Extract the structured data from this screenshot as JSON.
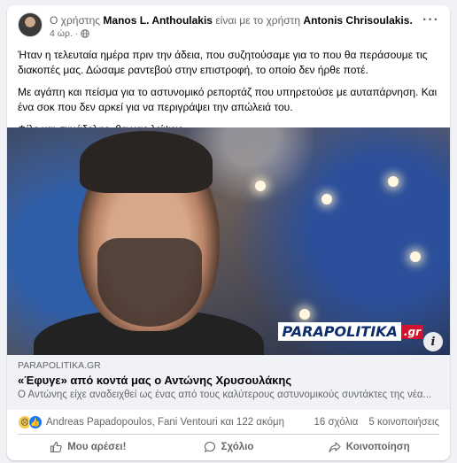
{
  "post": {
    "headline_prefix": "Ο χρήστης",
    "author": "Manos L. Anthoulakis",
    "headline_middle": "είναι με το χρήστη",
    "tagged": "Antonis Chrisoulakis.",
    "time": "4 ώρ.",
    "visibility_icon": "globe-icon",
    "more_icon": "more-dots-icon",
    "paragraphs": [
      "Ήταν η τελευταία ημέρα πριν την άδεια, που συζητούσαμε για το που θα περάσουμε τις διακοπές μας. Δώσαμε ραντεβού στην επιστροφή, το οποίο δεν ήρθε ποτέ.",
      "Με αγάπη και πείσμα για το αστυνομικό ρεπορτάζ που υπηρετούσε με αυταπάρνηση. Και ένα σοκ που δεν αρκεί για να περιγράψει την απώλειά του.",
      "Φίλε και συνάδελφε, θα μας λείψεις."
    ]
  },
  "image": {
    "logo_main": "PARAPOLITIKA",
    "logo_suffix": ".gr",
    "info_label": "i"
  },
  "link": {
    "domain": "PARAPOLITIKA.GR",
    "title": "«Έφυγε» από κοντά μας ο Αντώνης Χρυσουλάκης",
    "description": "Ο Αντώνης είχε αναδειχθεί ως ένας από τους καλύτερους αστυνομικούς συντάκτες της νέα..."
  },
  "reactions": {
    "summary": "Andreas Papadopoulos, Fani Ventouri και 122 ακόμη",
    "comments": "16 σχόλια",
    "shares": "5 κοινοποιήσεις",
    "icons": [
      "sad-reaction-icon",
      "like-reaction-icon"
    ]
  },
  "actions": {
    "like": "Μου αρέσει!",
    "comment": "Σχόλιο",
    "share": "Κοινοποίηση"
  },
  "colors": {
    "brand_blue": "#1877f2",
    "text_secondary": "#65676b",
    "logo_red": "#d0142d",
    "logo_navy": "#0d2c6c"
  }
}
